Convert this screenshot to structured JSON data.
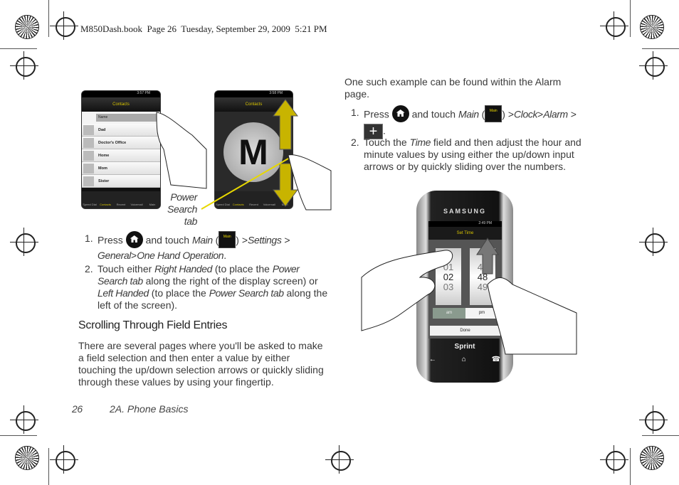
{
  "header": {
    "text": "M850Dash.book  Page 26  Tuesday, September 29, 2009  5:21 PM"
  },
  "figure_left": {
    "phone1": {
      "time": "3:57 PM",
      "title": "Contacts",
      "search_placeholder": "Name",
      "contacts": [
        "Dad",
        "Doctor's Office",
        "Home",
        "Mom",
        "Sister"
      ],
      "nav": [
        "Speed Dial",
        "Contacts",
        "Recent",
        "Voicemail",
        "Main"
      ]
    },
    "phone2": {
      "time": "3:58 PM",
      "title": "Contacts",
      "letter": "M",
      "nav": [
        "Speed Dial",
        "Contacts",
        "Recent",
        "Voicemail",
        "Main"
      ]
    },
    "callout": [
      "Power",
      "Search",
      "tab"
    ]
  },
  "left": {
    "step1": {
      "num": "1.",
      "press": "Press",
      "and_touch": "and touch",
      "main": "Main",
      "paren_open": "(",
      "paren_close": ")",
      "sep1": ">",
      "settings": "Settings",
      "sep2": ">",
      "general": "General",
      "sep3": ">",
      "one_hand": "One Hand Operation",
      "end": "."
    },
    "step2": {
      "num": "2.",
      "t1": "Touch either ",
      "right": "Right Handed",
      "t2": " (to place the ",
      "pst1": "Power Search tab",
      "t3": " along the right of the display screen) or ",
      "left": "Left Handed",
      "t4": " (to place the ",
      "pst2": "Power Search tab",
      "t5": " along the left of the screen)."
    },
    "heading": "Scrolling Through Field Entries",
    "paragraph": "There are several pages where you'll be asked to make a field selection and then enter a value by either touching the up/down selection arrows or quickly sliding through these values by using your fingertip."
  },
  "right": {
    "intro": "One such example can be found within the Alarm page.",
    "step1": {
      "num": "1.",
      "press": "Press",
      "and_touch": "and touch",
      "main": "Main",
      "paren_open": "(",
      "paren_close": ")",
      "sep1": ">",
      "clock": "Clock",
      "sep2": ">",
      "alarm": "Alarm",
      "sep3": ">",
      "end": "."
    },
    "step2": {
      "num": "2.",
      "t1": "Touch the ",
      "time": "Time",
      "t2": " field and then adjust the hour and minute values by using either the up/down input arrows or by quickly sliding over the numbers."
    },
    "phone": {
      "brand": "SAMSUNG",
      "time": "2:49 PM",
      "title": "Set Time",
      "hours": [
        "01",
        "02",
        "03"
      ],
      "minutes": [
        "47",
        "48",
        "49"
      ],
      "am": "am",
      "pm": "pm",
      "done": "Done",
      "carrier": "Sprint"
    }
  },
  "icons": {
    "main_label": "Main"
  },
  "footer": {
    "page": "26",
    "section": "2A. Phone Basics"
  }
}
